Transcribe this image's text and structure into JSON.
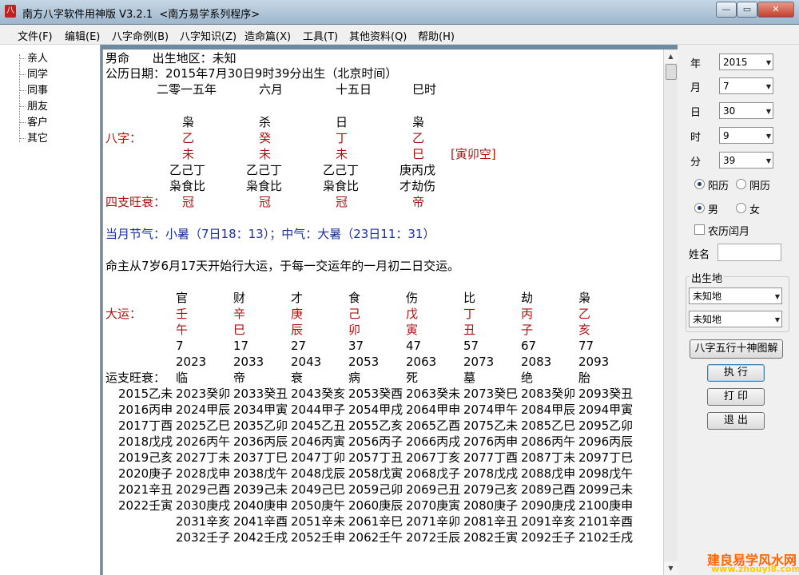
{
  "window": {
    "title": "南方八字软件用神版 V3.2.1  <南方易学系列程序>",
    "minimize": "—",
    "restore": "▭",
    "close": "✕"
  },
  "menu": [
    "文件(F)",
    "编辑(E)",
    "八字命例(B)",
    "八字知识(Z)",
    "造命篇(X)",
    "工具(T)",
    "其他资料(Q)",
    "帮助(H)"
  ],
  "sidebar": [
    "亲人",
    "同学",
    "同事",
    "朋友",
    "客户",
    "其它"
  ],
  "chart": {
    "header_line1": "男命      出生地区：未知",
    "header_line2": "公历日期：2015年7月30日9时39分出生（北京时间）",
    "lunar": [
      "二零一五年",
      "六月",
      "十五日",
      "巳时"
    ],
    "stem_gods": [
      "枭",
      "杀",
      "日",
      "枭"
    ],
    "bazi_label": "八字：",
    "stems": [
      "乙",
      "癸",
      "丁",
      "乙"
    ],
    "branches": [
      "未",
      "未",
      "未",
      "巳"
    ],
    "kongwang": "[寅卯空]",
    "hidden_stems": [
      "乙己丁",
      "乙己丁",
      "乙己丁",
      "庚丙戊"
    ],
    "hidden_gods": [
      "枭食比",
      "枭食比",
      "枭食比",
      "才劫伤"
    ],
    "wangshuai_label": "四支旺衰：",
    "wangshuai": [
      "冠",
      "冠",
      "冠",
      "帝"
    ],
    "jieqi": "当月节气：小暑（7日18：13）；中气：大暑（23日11：31）",
    "dayun_intro": "命主从7岁6月17天开始行大运，于每一交运年的一月初二日交运。",
    "dayun_gods": [
      "官",
      "财",
      "才",
      "食",
      "伤",
      "比",
      "劫",
      "枭"
    ],
    "dayun_label": "大运：",
    "dayun_stems": [
      "壬",
      "辛",
      "庚",
      "己",
      "戊",
      "丁",
      "丙",
      "乙"
    ],
    "dayun_branches": [
      "午",
      "巳",
      "辰",
      "卯",
      "寅",
      "丑",
      "子",
      "亥"
    ],
    "dayun_ages": [
      "7",
      "17",
      "27",
      "37",
      "47",
      "57",
      "67",
      "77"
    ],
    "dayun_years": [
      "2023",
      "2033",
      "2043",
      "2053",
      "2063",
      "2073",
      "2083",
      "2093"
    ],
    "yunzhi_label": "运支旺衰：",
    "yunzhi": [
      "临",
      "帝",
      "衰",
      "病",
      "死",
      "墓",
      "绝",
      "胎"
    ],
    "liunian_pre": [
      "2015乙未",
      "2016丙申",
      "2017丁酉",
      "2018戊戌",
      "2019己亥",
      "2020庚子",
      "2021辛丑",
      "2022壬寅"
    ],
    "liunian": [
      [
        "2023癸卯",
        "2024甲辰",
        "2025乙巳",
        "2026丙午",
        "2027丁未",
        "2028戊申",
        "2029己酉",
        "2030庚戌",
        "2031辛亥",
        "2032壬子"
      ],
      [
        "2033癸丑",
        "2034甲寅",
        "2035乙卯",
        "2036丙辰",
        "2037丁巳",
        "2038戊午",
        "2039己未",
        "2040庚申",
        "2041辛酉",
        "2042壬戌"
      ],
      [
        "2043癸亥",
        "2044甲子",
        "2045乙丑",
        "2046丙寅",
        "2047丁卯",
        "2048戊辰",
        "2049己巳",
        "2050庚午",
        "2051辛未",
        "2052壬申"
      ],
      [
        "2053癸酉",
        "2054甲戌",
        "2055乙亥",
        "2056丙子",
        "2057丁丑",
        "2058戊寅",
        "2059己卯",
        "2060庚辰",
        "2061辛巳",
        "2062壬午"
      ],
      [
        "2063癸未",
        "2064甲申",
        "2065乙酉",
        "2066丙戌",
        "2067丁亥",
        "2068戊子",
        "2069己丑",
        "2070庚寅",
        "2071辛卯",
        "2072壬辰"
      ],
      [
        "2073癸巳",
        "2074甲午",
        "2075乙未",
        "2076丙申",
        "2077丁酉",
        "2078戊戌",
        "2079己亥",
        "2080庚子",
        "2081辛丑",
        "2082壬寅"
      ],
      [
        "2083癸卯",
        "2084甲辰",
        "2085乙巳",
        "2086丙午",
        "2087丁未",
        "2088戊申",
        "2089己酉",
        "2090庚戌",
        "2091辛亥",
        "2092壬子"
      ],
      [
        "2093癸丑",
        "2094甲寅",
        "2095乙卯",
        "2096丙辰",
        "2097丁巳",
        "2098戊午",
        "2099己未",
        "2100庚申",
        "2101辛酉",
        "2102壬戌"
      ]
    ]
  },
  "form": {
    "year_label": "年",
    "year": "2015",
    "month_label": "月",
    "month": "7",
    "day_label": "日",
    "day": "30",
    "hour_label": "时",
    "hour": "9",
    "minute_label": "分",
    "minute": "39",
    "solar": "阳历",
    "lunar": "阴历",
    "male": "男",
    "female": "女",
    "leap": "农历闰月",
    "name_label": "姓名",
    "birthplace_label": "出生地",
    "place1": "未知地",
    "place2": "未知地",
    "diagram_btn": "八字五行十神图解",
    "run_btn": "执 行",
    "print_btn": "打 印",
    "exit_btn": "退 出"
  },
  "watermark": {
    "line1": "建良易学风水网",
    "line2": "www.zhouyi8.com"
  },
  "colors": {
    "red_text": "#b01010",
    "blue_text": "#1a2fa0",
    "watermark": "#ff6600"
  }
}
